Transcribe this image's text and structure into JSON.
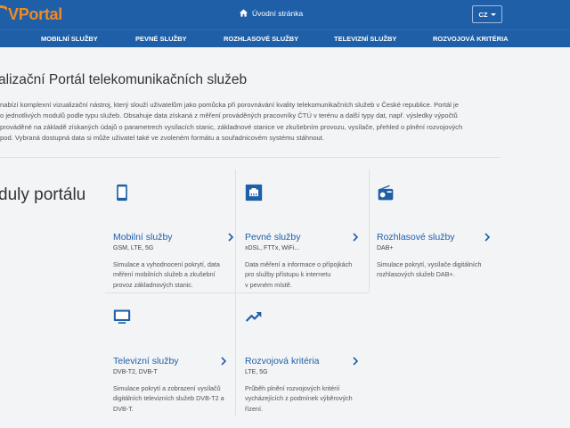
{
  "header": {
    "logo_text": "Portal",
    "logo_v": "V",
    "home_label": "Úvodní stránka",
    "lang": "CZ"
  },
  "nav": {
    "items": [
      {
        "label": "MOBILNÍ SLUŽBY"
      },
      {
        "label": "PEVNÉ SLUŽBY"
      },
      {
        "label": "ROZHLASOVÉ SLUŽBY"
      },
      {
        "label": "TELEVIZNÍ SLUŽBY"
      },
      {
        "label": "ROZVOJOVÁ KRITÉRIA"
      }
    ]
  },
  "main": {
    "title": "alizační Portál telekomunikačních služeb",
    "intro_lines": [
      "nabízí komplexní vizualizační nástroj, který slouží uživatelům jako pomůcka při porovnávání kvality telekomunikačních služeb v České republice. Portál je",
      "o jednotlivých modulů podle typu služeb. Obsahuje data získaná z měření prováděných pracovníky ČTÚ v terénu a další typy dat, např. výsledky výpočtů",
      "prováděné na základě získaných údajů o parametrech vysílacích stanic, základnové stanice ve zkušebním provozu, vysílače, přehled o plnění rozvojových",
      "pod. Vybraná dostupná data si může uživatel také ve zvoleném formátu a souřadnicovém systému stáhnout."
    ],
    "modules_heading": "duly portálu"
  },
  "modules": [
    {
      "icon": "smartphone-icon",
      "title": "Mobilní služby",
      "subtitle": "GSM, LTE, 5G",
      "desc": [
        "Simulace a vyhodnocení pokrytí, data",
        "měření mobilních služeb a zkušební",
        "provoz základnových stanic."
      ]
    },
    {
      "icon": "network-port-icon",
      "title": "Pevné služby",
      "subtitle": "xDSL, FTTx, WiFi...",
      "desc": [
        "Data měření a informace o přípojkách",
        "pro služby přístupu k internetu",
        "v pevném místě."
      ]
    },
    {
      "icon": "radio-icon",
      "title": "Rozhlasové služby",
      "subtitle": "DAB+",
      "desc": [
        "Simulace pokrytí, vysílače digitálních",
        "rozhlasových služeb DAB+."
      ]
    },
    {
      "icon": "tv-icon",
      "title": "Televizní služby",
      "subtitle": "DVB-T2, DVB-T",
      "desc": [
        "Simulace pokrytí a zobrazení vysílačů",
        "digitálních televizních služeb DVB-T2 a",
        "DVB-T."
      ]
    },
    {
      "icon": "trending-up-icon",
      "title": "Rozvojová kritéria",
      "subtitle": "LTE, 5G",
      "desc": [
        "Průběh plnění rozvojových kritérií",
        "vycházejících z podmínek výběrových",
        "řízení."
      ]
    }
  ],
  "colors": {
    "brand_blue": "#1e5fa8",
    "logo_orange": "#f08a24"
  }
}
